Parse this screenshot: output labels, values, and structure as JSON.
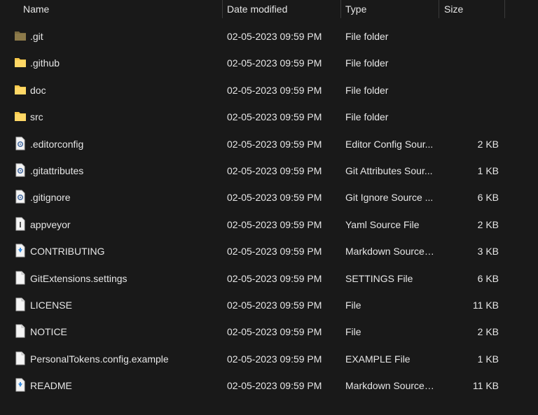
{
  "columns": {
    "name": "Name",
    "date": "Date modified",
    "type": "Type",
    "size": "Size"
  },
  "files": [
    {
      "name": ".git",
      "date": "02-05-2023 09:59 PM",
      "type": "File folder",
      "size": "",
      "icon": "folder-dark-icon"
    },
    {
      "name": ".github",
      "date": "02-05-2023 09:59 PM",
      "type": "File folder",
      "size": "",
      "icon": "folder-icon"
    },
    {
      "name": "doc",
      "date": "02-05-2023 09:59 PM",
      "type": "File folder",
      "size": "",
      "icon": "folder-icon"
    },
    {
      "name": "src",
      "date": "02-05-2023 09:59 PM",
      "type": "File folder",
      "size": "",
      "icon": "folder-icon"
    },
    {
      "name": ".editorconfig",
      "date": "02-05-2023 09:59 PM",
      "type": "Editor Config Sour...",
      "size": "2 KB",
      "icon": "config-file-icon"
    },
    {
      "name": ".gitattributes",
      "date": "02-05-2023 09:59 PM",
      "type": "Git Attributes Sour...",
      "size": "1 KB",
      "icon": "config-file-icon"
    },
    {
      "name": ".gitignore",
      "date": "02-05-2023 09:59 PM",
      "type": "Git Ignore Source ...",
      "size": "6 KB",
      "icon": "config-file-icon"
    },
    {
      "name": "appveyor",
      "date": "02-05-2023 09:59 PM",
      "type": "Yaml Source File",
      "size": "2 KB",
      "icon": "yaml-file-icon"
    },
    {
      "name": "CONTRIBUTING",
      "date": "02-05-2023 09:59 PM",
      "type": "Markdown Source ...",
      "size": "3 KB",
      "icon": "markdown-file-icon"
    },
    {
      "name": "GitExtensions.settings",
      "date": "02-05-2023 09:59 PM",
      "type": "SETTINGS File",
      "size": "6 KB",
      "icon": "file-icon"
    },
    {
      "name": "LICENSE",
      "date": "02-05-2023 09:59 PM",
      "type": "File",
      "size": "11 KB",
      "icon": "file-icon"
    },
    {
      "name": "NOTICE",
      "date": "02-05-2023 09:59 PM",
      "type": "File",
      "size": "2 KB",
      "icon": "file-icon"
    },
    {
      "name": "PersonalTokens.config.example",
      "date": "02-05-2023 09:59 PM",
      "type": "EXAMPLE File",
      "size": "1 KB",
      "icon": "file-icon"
    },
    {
      "name": "README",
      "date": "02-05-2023 09:59 PM",
      "type": "Markdown Source ...",
      "size": "11 KB",
      "icon": "markdown-file-icon"
    }
  ],
  "colors": {
    "background": "#191919",
    "text": "#e6e6e6",
    "folder": "#f8c94a",
    "folder_dark": "#8c7a4a",
    "markdown_accent": "#3d8ee0"
  }
}
